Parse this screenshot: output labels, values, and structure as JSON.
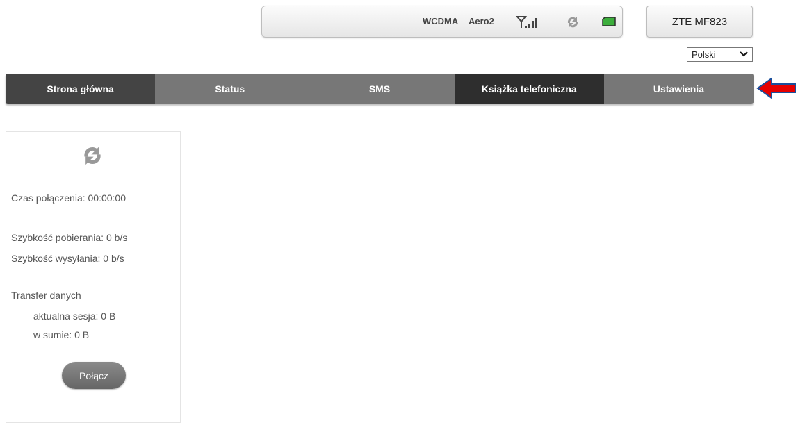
{
  "status": {
    "network_type": "WCDMA",
    "operator": "Aero2",
    "signal_icon": "signal-bars-icon",
    "sync_icon": "refresh-icon",
    "sim_icon": "sim-card-icon"
  },
  "device": {
    "name": "ZTE MF823"
  },
  "language": {
    "selected": "Polski",
    "chevron": "❯"
  },
  "nav": {
    "tabs": [
      {
        "label": "Strona główna",
        "color": "#444444"
      },
      {
        "label": "Status",
        "color": "#777777"
      },
      {
        "label": "SMS",
        "color": "#777777"
      },
      {
        "label": "Książka telefoniczna",
        "color": "#2e2e2e"
      },
      {
        "label": "Ustawienia",
        "color": "#777777"
      }
    ]
  },
  "panel": {
    "refresh_icon": "refresh-icon",
    "connection_time": "Czas połączenia: 00:00:00",
    "download_speed": "Szybkość pobierania: 0 b/s",
    "upload_speed": "Szybkość wysyłania: 0 b/s",
    "transfer_title": "Transfer danych",
    "current_session": "aktualna sesja: 0 B",
    "total": "w sumie: 0 B",
    "connect_label": "Połącz"
  },
  "colors": {
    "arrow_fill": "#e60000",
    "arrow_stroke": "#1a4f9c",
    "sim_green": "#3cae3c"
  }
}
